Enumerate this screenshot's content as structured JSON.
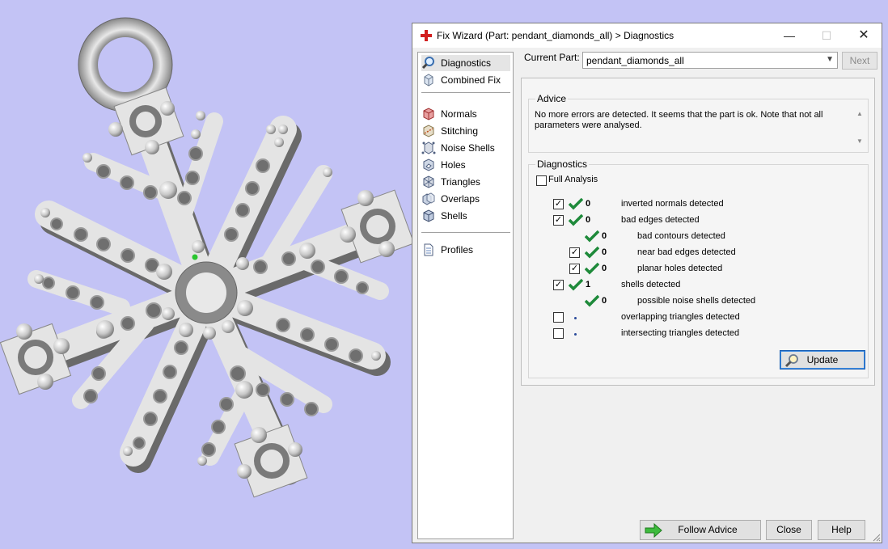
{
  "window": {
    "title": "Fix Wizard (Part: pendant_diamonds_all) > Diagnostics",
    "minimize": "—",
    "maximize": "☐",
    "close": "✕"
  },
  "nav": {
    "items": [
      {
        "label": "Diagnostics",
        "icon": "magnifier-icon",
        "selected": true
      },
      {
        "label": "Combined Fix",
        "icon": "cube-icon"
      },
      {
        "label": "Normals",
        "icon": "normals-icon"
      },
      {
        "label": "Stitching",
        "icon": "stitching-icon"
      },
      {
        "label": "Noise Shells",
        "icon": "noise-shells-icon"
      },
      {
        "label": "Holes",
        "icon": "holes-icon"
      },
      {
        "label": "Triangles",
        "icon": "triangles-icon"
      },
      {
        "label": "Overlaps",
        "icon": "overlaps-icon"
      },
      {
        "label": "Shells",
        "icon": "shells-icon"
      },
      {
        "label": "Profiles",
        "icon": "document-icon"
      }
    ]
  },
  "current_part": {
    "label": "Current Part:",
    "value": "pendant_diamonds_all",
    "next_label": "Next"
  },
  "advice": {
    "title": "Advice",
    "text": "No more errors are detected. It seems that the part is ok. Note that not all parameters were analysed."
  },
  "diagnostics": {
    "title": "Diagnostics",
    "full_analysis_label": "Full Analysis",
    "full_analysis_checked": false,
    "rows": [
      {
        "checked": true,
        "status": "ok",
        "count": "0",
        "label": "inverted normals detected"
      },
      {
        "checked": true,
        "status": "ok",
        "count": "0",
        "label": "bad edges detected"
      },
      {
        "checked": null,
        "status": "ok",
        "count": "0",
        "label": "bad contours detected"
      },
      {
        "checked": true,
        "status": "ok",
        "count": "0",
        "label": "near bad edges detected"
      },
      {
        "checked": true,
        "status": "ok",
        "count": "0",
        "label": "planar holes detected"
      },
      {
        "checked": true,
        "status": "ok",
        "count": "1",
        "label": "shells detected"
      },
      {
        "checked": null,
        "status": "ok",
        "count": "0",
        "label": "possible noise shells detected"
      },
      {
        "checked": false,
        "status": "pending",
        "count": "",
        "label": "overlapping triangles detected"
      },
      {
        "checked": false,
        "status": "pending",
        "count": "",
        "label": "intersecting triangles detected"
      }
    ],
    "update_label": "Update"
  },
  "buttons": {
    "follow_advice": "Follow Advice",
    "close": "Close",
    "help": "Help"
  },
  "colors": {
    "viewport_bg": "#c3c3f5",
    "check_green": "#1e8a3a",
    "accent_blue": "#1a5fb4"
  }
}
